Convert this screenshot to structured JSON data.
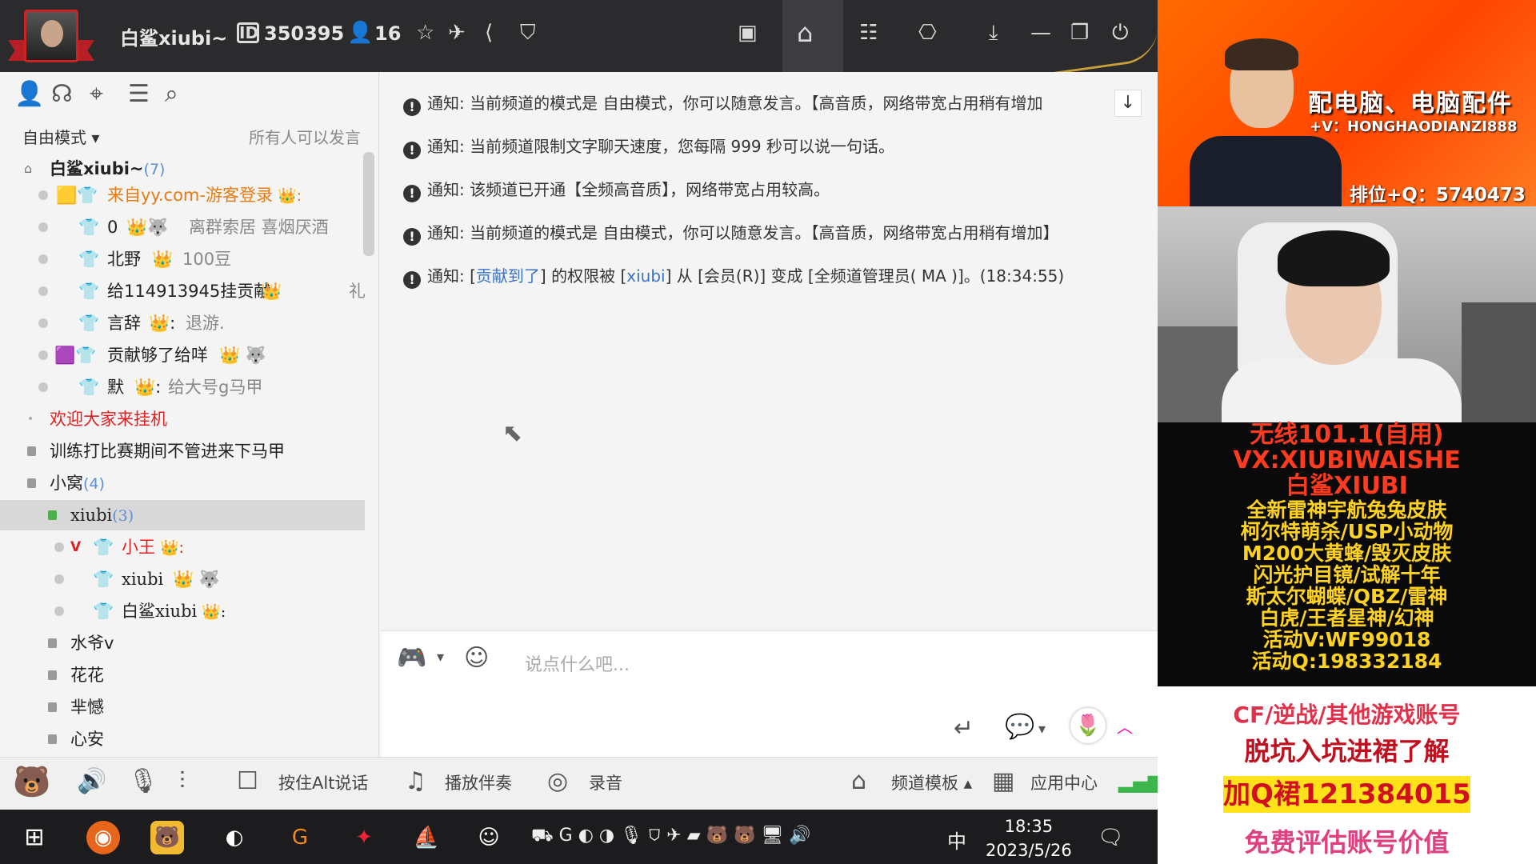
{
  "header": {
    "channel_name": "白鲨xiubi~",
    "channel_id": "350395",
    "online_count": "16"
  },
  "left_panel": {
    "mode": "自由模式",
    "mode_desc": "所有人可以发言",
    "tree": [
      {
        "text": "白鲨xiubi~",
        "count": "(7)"
      },
      {
        "text": "来自yy.com-游客登录",
        "badge": "👑:"
      },
      {
        "text": "0",
        "extra": "离群索居 喜烟厌酒"
      },
      {
        "text": "北野",
        "extra": "100豆"
      },
      {
        "text": "给114913945挂贡献",
        "extra": "礼"
      },
      {
        "text": "言辞",
        "extra": "退游."
      },
      {
        "text": "贡献够了给咩"
      },
      {
        "text": "默",
        "extra": "给大号g马甲"
      },
      {
        "text": "欢迎大家来挂机"
      },
      {
        "text": "训练打比赛期间不管进来下马甲"
      },
      {
        "text": "小窝",
        "count": "(4)"
      },
      {
        "text": "xiubi",
        "count": "(3)"
      },
      {
        "text": "小王",
        "badge": "👑:"
      },
      {
        "text": "xiubi"
      },
      {
        "text": "白鲨xiubi",
        "badge": "👑:"
      },
      {
        "text": "水爷v"
      },
      {
        "text": "花花"
      },
      {
        "text": "芈憾"
      },
      {
        "text": "心安"
      }
    ]
  },
  "chat": {
    "notices": [
      {
        "label": "通知:",
        "text": "当前频道的模式是 自由模式，你可以随意发言。【高音质，网络带宽占用稍有增加"
      },
      {
        "label": "通知:",
        "text": "当前频道限制文字聊天速度，您每隔 999 秒可以说一句话。"
      },
      {
        "label": "通知:",
        "text": "该频道已开通【全频高音质】，网络带宽占用较高。"
      },
      {
        "label": "通知:",
        "text": "当前频道的模式是 自由模式，你可以随意发言。【高音质，网络带宽占用稍有增加】"
      },
      {
        "label": "通知:",
        "p1": "[",
        "l1": "贡献到了",
        "p2": "] 的权限被 [",
        "l2": "xiubi",
        "p3": "] 从 [会员(R)] 变成 [全频道管理员( MA )]。(18:34:55)"
      }
    ],
    "input_placeholder": "说点什么吧..."
  },
  "bottom_bar": {
    "push_to_talk": "按住Alt说话",
    "play_music": "播放伴奏",
    "record": "录音",
    "channel_template": "频道模板",
    "app_center": "应用中心"
  },
  "taskbar": {
    "ime": "中",
    "time": "18:35",
    "date": "2023/5/26"
  },
  "side_ads": {
    "ad1_line1": "配电脑、电脑配件",
    "ad1_line2": "+V：HONGHAODIANZI888",
    "ad1_line3": "排位+Q：5740473",
    "ad2_lines": [
      {
        "t": "无线101.1(自用)",
        "c": "red"
      },
      {
        "t": "VX:XIUBIWAISHE",
        "c": "red"
      },
      {
        "t": "白鲨XIUBI",
        "c": "red"
      },
      {
        "t": "全新雷神宇航兔兔皮肤",
        "c": "yel"
      },
      {
        "t": "柯尔特萌杀/USP小动物",
        "c": "yel"
      },
      {
        "t": "M200大黄蜂/毁灭皮肤",
        "c": "yel"
      },
      {
        "t": "闪光护目镜/试解十年",
        "c": "yel"
      },
      {
        "t": "斯太尔蝴蝶/QBZ/雷神",
        "c": "yel"
      },
      {
        "t": "白虎/王者星神/幻神",
        "c": "yel"
      },
      {
        "t": "活动V:WF99018",
        "c": "yel"
      },
      {
        "t": "活动Q:198332184",
        "c": "yel"
      }
    ],
    "ad3_line1": "CF/逆战/其他游戏账号",
    "ad3_line2": "脱坑入坑进裙了解",
    "ad3_line3": "加Q裙121384015",
    "ad3_line4": "免费评估账号价值"
  },
  "colors": {
    "topbar": "#2b2b2d",
    "accent_red": "#e02020",
    "orange_text": "#e87a12",
    "link_blue": "#3a72c4",
    "gold": "#c8a039"
  }
}
